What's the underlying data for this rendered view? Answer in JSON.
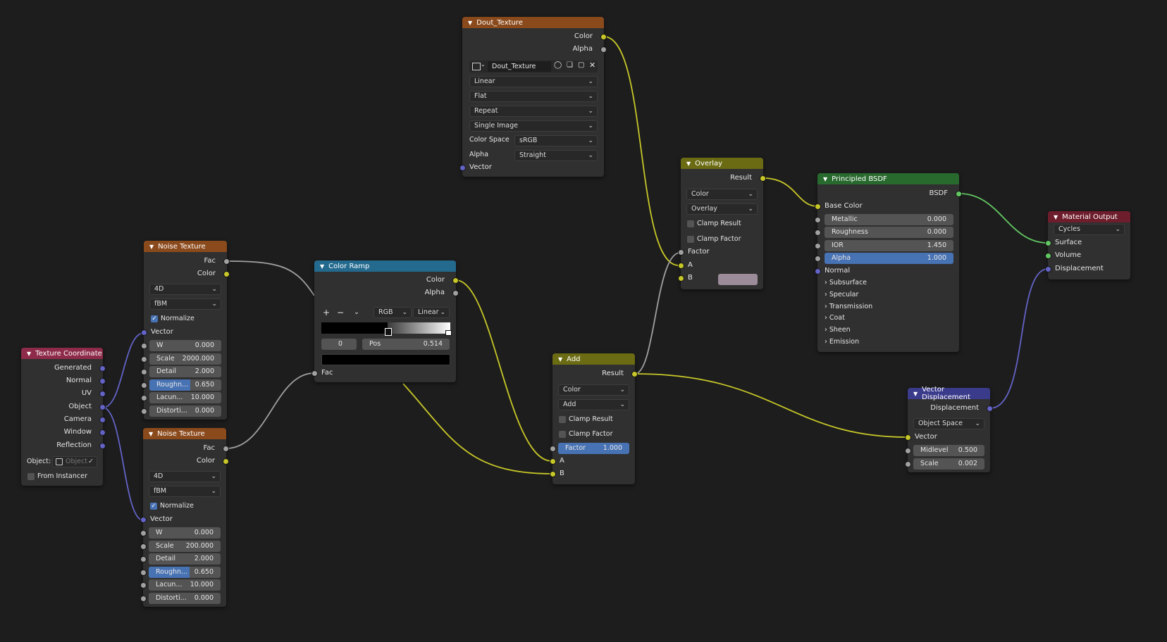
{
  "colors": {
    "background": "#1d1d1d",
    "node_body": "#303030",
    "header_texture": "#8b4a1c",
    "header_converter": "#236a8e",
    "header_input": "#8e2b4a",
    "header_shader": "#28692e",
    "header_output": "#6e1d2c",
    "header_color": "#6b6b14",
    "header_vector": "#3b3b8c",
    "socket_color": "#c7c729",
    "socket_float": "#a1a1a1",
    "socket_vector": "#6363c7",
    "socket_shader": "#63c763",
    "accent_blue": "#4772b3"
  },
  "nodes": {
    "texcoord": {
      "title": "Texture Coordinate",
      "outputs": [
        "Generated",
        "Normal",
        "UV",
        "Object",
        "Camera",
        "Window",
        "Reflection"
      ],
      "object_label": "Object:",
      "object_placeholder": "Object",
      "from_instancer": "From Instancer",
      "icon_object": "object-box-icon",
      "icon_eyedropper": "eyedropper-icon"
    },
    "noise1": {
      "title": "Noise Texture",
      "outputs": [
        "Fac",
        "Color"
      ],
      "dimensions": "4D",
      "type": "fBM",
      "normalize": "Normalize",
      "normalize_checked": true,
      "vector": "Vector",
      "fields": [
        {
          "label": "W",
          "value": "0.000"
        },
        {
          "label": "Scale",
          "value": "2000.000"
        },
        {
          "label": "Detail",
          "value": "2.000"
        },
        {
          "label": "Roughn...",
          "value": "0.650",
          "fill": 0.65
        },
        {
          "label": "Lacun...",
          "value": "10.000"
        },
        {
          "label": "Distorti...",
          "value": "0.000"
        }
      ]
    },
    "noise2": {
      "title": "Noise Texture",
      "outputs": [
        "Fac",
        "Color"
      ],
      "dimensions": "4D",
      "type": "fBM",
      "normalize": "Normalize",
      "normalize_checked": true,
      "vector": "Vector",
      "fields": [
        {
          "label": "W",
          "value": "0.000"
        },
        {
          "label": "Scale",
          "value": "200.000"
        },
        {
          "label": "Detail",
          "value": "2.000"
        },
        {
          "label": "Roughn...",
          "value": "0.650",
          "fill": 0.65
        },
        {
          "label": "Lacun...",
          "value": "10.000"
        },
        {
          "label": "Distorti...",
          "value": "0.000"
        }
      ]
    },
    "colorramp": {
      "title": "Color Ramp",
      "outputs": [
        "Color",
        "Alpha"
      ],
      "add": "+",
      "remove": "−",
      "mode": "RGB",
      "interp": "Linear",
      "index": "0",
      "pos_label": "Pos",
      "pos_value": "0.514",
      "input": "Fac"
    },
    "image": {
      "title": "Dout_Texture",
      "outputs": [
        "Color",
        "Alpha"
      ],
      "image_name": "Dout_Texture",
      "interp": "Linear",
      "projection": "Flat",
      "extension": "Repeat",
      "source": "Single Image",
      "colorspace_label": "Color Space",
      "colorspace": "sRGB",
      "alpha_label": "Alpha",
      "alpha": "Straight",
      "input": "Vector"
    },
    "overlay": {
      "title": "Overlay",
      "output": "Result",
      "data_type": "Color",
      "blend": "Overlay",
      "clamp_result": "Clamp Result",
      "clamp_factor": "Clamp Factor",
      "inputs": [
        "Factor",
        "A",
        "B"
      ],
      "b_color": "#9c8b98"
    },
    "add": {
      "title": "Add",
      "output": "Result",
      "data_type": "Color",
      "blend": "Add",
      "clamp_result": "Clamp Result",
      "clamp_factor": "Clamp Factor",
      "factor_label": "Factor",
      "factor_value": "1.000",
      "inputs": [
        "A",
        "B"
      ]
    },
    "bsdf": {
      "title": "Principled BSDF",
      "output": "BSDF",
      "base_color": "Base Color",
      "fields": [
        {
          "label": "Metallic",
          "value": "0.000"
        },
        {
          "label": "Roughness",
          "value": "0.000"
        },
        {
          "label": "IOR",
          "value": "1.450"
        },
        {
          "label": "Alpha",
          "value": "1.000",
          "fill": 1.0
        }
      ],
      "normal": "Normal",
      "panels": [
        "Subsurface",
        "Specular",
        "Transmission",
        "Coat",
        "Sheen",
        "Emission"
      ]
    },
    "output": {
      "title": "Material Output",
      "target": "Cycles",
      "inputs": [
        "Surface",
        "Volume",
        "Displacement"
      ]
    },
    "vecdisp": {
      "title": "Vector Displacement",
      "output": "Displacement",
      "space": "Object Space",
      "vector": "Vector",
      "fields": [
        {
          "label": "Midlevel",
          "value": "0.500"
        },
        {
          "label": "Scale",
          "value": "0.002"
        }
      ]
    }
  }
}
